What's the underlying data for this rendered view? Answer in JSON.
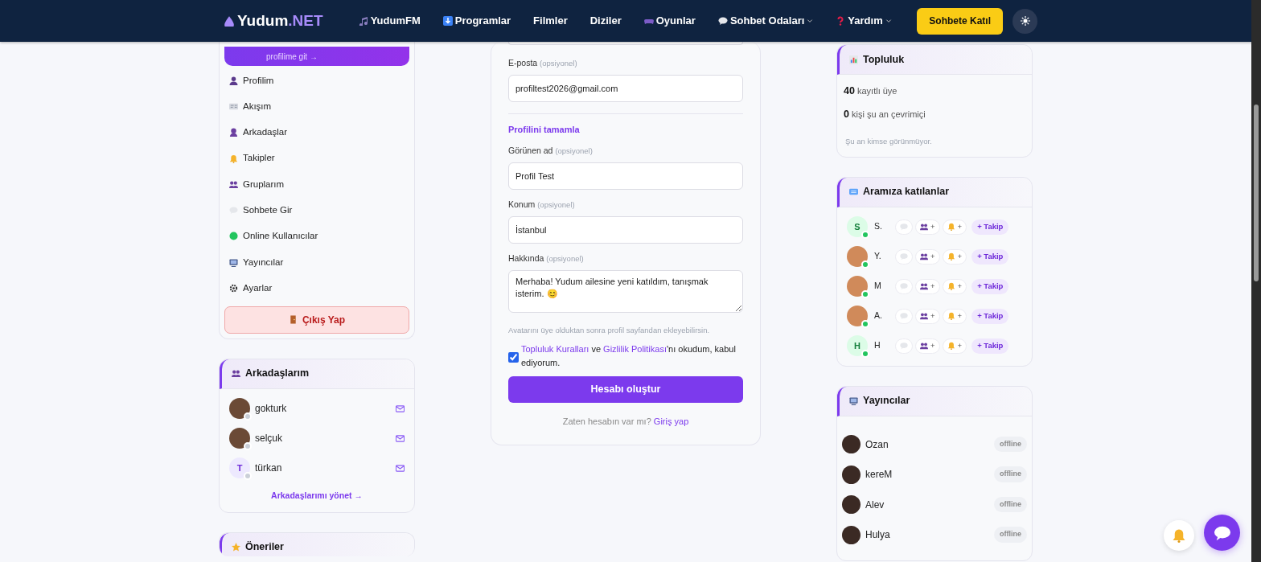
{
  "navbar": {
    "brand_main": "Yudum",
    "brand_suffix": ".NET",
    "items": [
      {
        "label": "YudumFM",
        "dropdown": false
      },
      {
        "label": "Programlar",
        "dropdown": false
      },
      {
        "label": "Filmler",
        "dropdown": false
      },
      {
        "label": "Diziler",
        "dropdown": false
      },
      {
        "label": "Oyunlar",
        "dropdown": false
      },
      {
        "label": "Sohbet Odaları",
        "dropdown": true
      },
      {
        "label": "Yardım",
        "dropdown": true
      }
    ],
    "join_button": "Sohbete Katıl"
  },
  "sidebar": {
    "profile_link": "profilime git →",
    "items": [
      {
        "label": "Profilim"
      },
      {
        "label": "Akışım"
      },
      {
        "label": "Arkadaşlar"
      },
      {
        "label": "Takipler"
      },
      {
        "label": "Gruplarım"
      },
      {
        "label": "Sohbete Gir"
      },
      {
        "label": "Online Kullanıcılar"
      },
      {
        "label": "Yayıncılar"
      },
      {
        "label": "Ayarlar"
      }
    ],
    "logout": "Çıkış Yap"
  },
  "friends": {
    "title": "Arkadaşlarım",
    "items": [
      {
        "name": "gokturk",
        "online": false
      },
      {
        "name": "selçuk",
        "online": false
      },
      {
        "name": "türkan",
        "initial": "T",
        "online": false
      }
    ],
    "manage_link": "Arkadaşlarımı yönet →"
  },
  "suggestions": {
    "title": "Öneriler"
  },
  "form": {
    "email": {
      "label": "E-posta",
      "hint": "(opsiyonel)",
      "value": "profiltest2026@gmail.com"
    },
    "section_title": "Profilini tamamla",
    "fields": [
      {
        "kind": "input",
        "label": "Görünen ad",
        "hint": "(opsiyonel)",
        "value": "Profil Test"
      },
      {
        "kind": "input",
        "label": "Konum",
        "hint": "(opsiyonel)",
        "value": "İstanbul"
      },
      {
        "kind": "textarea",
        "label": "Hakkında",
        "hint": "(opsiyonel)",
        "value": "Merhaba! Yudum ailesine yeni katıldım, tanışmak isterim. 😊"
      }
    ],
    "avatar_note": "Avatarını üye olduktan sonra profil sayfandan ekleyebilirsin.",
    "terms": {
      "checked": true,
      "link_1": "Topluluk Kuralları",
      "between": " ve ",
      "link_2": "Gizlilik Politikası",
      "after": "'nı okudum, kabul ediyorum."
    },
    "submit": "Hesabı oluştur",
    "login_prompt": "Zaten hesabın var mı?",
    "login_link": "Giriş yap"
  },
  "community": {
    "title": "Topluluk",
    "stats": [
      "**40** kayıtlı üye",
      "**0** kişi şu an çevrimiçi"
    ],
    "note": "Şu an kimse görünmüyor."
  },
  "newcomers": {
    "title": "Aramıza katılanlar",
    "items": [
      {
        "name": "S.",
        "initial": "S",
        "online": true,
        "friend_label": "+",
        "notify_label": "+",
        "follow_label": "+ Takip"
      },
      {
        "name": "Y.",
        "online": true,
        "friend_label": "+",
        "notify_label": "+",
        "follow_label": "+ Takip"
      },
      {
        "name": "M",
        "online": true,
        "friend_label": "+",
        "notify_label": "+",
        "follow_label": "+ Takip"
      },
      {
        "name": "A.",
        "online": true,
        "friend_label": "+",
        "notify_label": "+",
        "follow_label": "+ Takip"
      },
      {
        "name": "H",
        "initial": "H",
        "online": true,
        "friend_label": "+",
        "notify_label": "+",
        "follow_label": "+ Takip"
      }
    ]
  },
  "streamers": {
    "title": "Yayıncılar",
    "items": [
      {
        "name": "Ozan",
        "status": "offline"
      },
      {
        "name": "kereM",
        "status": "offline"
      },
      {
        "name": "Alev",
        "status": "offline"
      },
      {
        "name": "Hulya",
        "status": "offline"
      }
    ]
  }
}
